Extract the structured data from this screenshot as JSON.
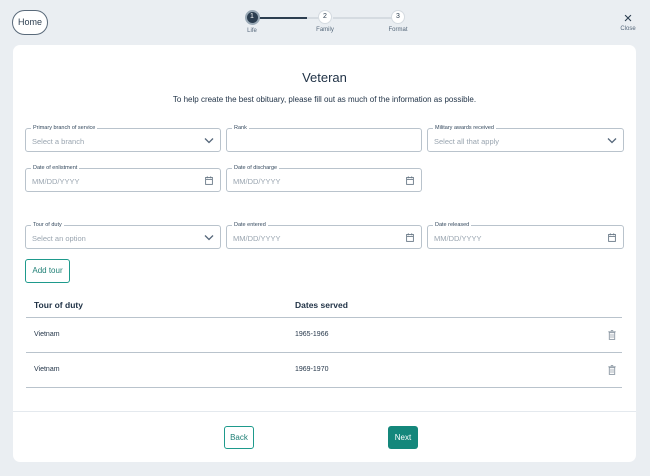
{
  "header": {
    "home_label": "Home",
    "close_label": "Close",
    "close_icon": "×",
    "steps": [
      {
        "number": "1",
        "label": "Life"
      },
      {
        "number": "2",
        "label": "Family"
      },
      {
        "number": "3",
        "label": "Format"
      }
    ],
    "current_step": 1
  },
  "form": {
    "title": "Veteran",
    "subtitle": "To help create the best obituary, please fill out as much of the information as possible.",
    "fields": {
      "branch": {
        "label": "Primary branch of service",
        "placeholder": "Select a branch"
      },
      "rank": {
        "label": "Rank",
        "placeholder": ""
      },
      "awards": {
        "label": "Military awards received",
        "placeholder": "Select all that apply"
      },
      "enlistment": {
        "label": "Date of enlistment",
        "placeholder": "MM/DD/YYYY"
      },
      "discharge": {
        "label": "Date of discharge",
        "placeholder": "MM/DD/YYYY"
      },
      "tour": {
        "label": "Tour of duty",
        "placeholder": "Select an option"
      },
      "entered": {
        "label": "Date entered",
        "placeholder": "MM/DD/YYYY"
      },
      "released": {
        "label": "Date released",
        "placeholder": "MM/DD/YYYY"
      }
    },
    "add_tour_label": "Add tour"
  },
  "tours_table": {
    "headers": [
      "Tour of duty",
      "Dates served"
    ],
    "rows": [
      {
        "tour": "Vietnam",
        "dates": "1965-1966"
      },
      {
        "tour": "Vietnam",
        "dates": "1969-1970"
      }
    ]
  },
  "footer": {
    "back_label": "Back",
    "next_label": "Next"
  },
  "colors": {
    "accent": "#14877b",
    "navy": "#2c3e50",
    "background": "#eaeef2"
  },
  "icons": [
    "chevron-down-icon",
    "calendar-icon",
    "trash-icon",
    "close-icon"
  ]
}
